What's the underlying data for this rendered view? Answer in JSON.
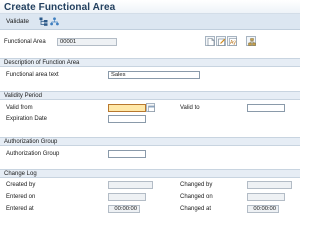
{
  "title": "Create Functional Area",
  "toolbar": {
    "validate_label": "Validate",
    "icons": [
      "hierarchy-icon",
      "org-structure-icon"
    ]
  },
  "header": {
    "functional_area_label": "Functional Area",
    "functional_area_value": "00001",
    "buttons": [
      "new-document-icon",
      "edit-icon",
      "ay-text-icon",
      "org-chart-icon"
    ]
  },
  "description_section": {
    "title": "Description of Function Area",
    "text_label": "Functional area text",
    "text_value": "Sales"
  },
  "validity_section": {
    "title": "Validity Period",
    "valid_from_label": "Valid from",
    "valid_from_value": "",
    "valid_to_label": "Valid to",
    "valid_to_value": "",
    "expiration_label": "Expiration Date",
    "expiration_value": ""
  },
  "authorization_section": {
    "title": "Authorization Group",
    "group_label": "Authorization Group",
    "group_value": ""
  },
  "change_log_section": {
    "title": "Change Log",
    "created_by_label": "Created by",
    "created_by_value": "",
    "entered_on_label": "Entered on",
    "entered_on_value": "",
    "entered_at_label": "Entered at",
    "entered_at_value": "00:00:00",
    "changed_by_label": "Changed by",
    "changed_by_value": "",
    "changed_on_label": "Changed on",
    "changed_on_value": "",
    "changed_at_label": "Changed at",
    "changed_at_value": "00:00:00"
  },
  "colors": {
    "title": "#23405f",
    "toolbar_bg": "#dce6f1",
    "section_bar": "#e6edf5",
    "mandatory_field": "#ffe8a8"
  }
}
